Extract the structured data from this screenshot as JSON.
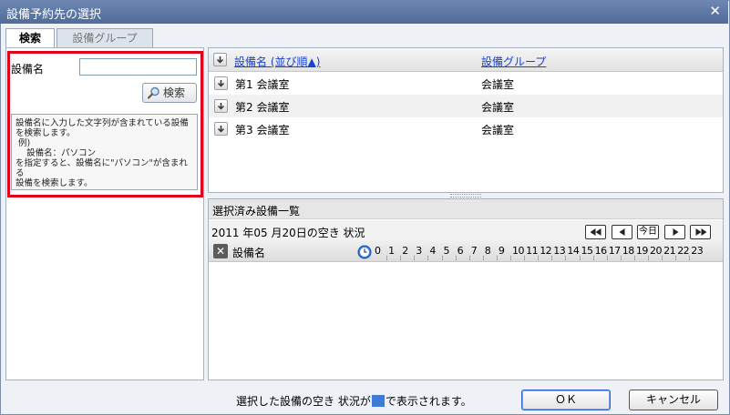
{
  "window": {
    "title": "設備予約先の選択"
  },
  "tabs": [
    {
      "label": "検索"
    },
    {
      "label": "設備グループ"
    }
  ],
  "search": {
    "label": "設備名",
    "input_value": "",
    "button_label": "検索",
    "help_text": "設備名に入力した文字列が含まれている設備\nを検索します。\n 例)\n    設備名：パソコン\nを指定すると、設備名に\"パソコン\"が含まれる\n設備を検索します。"
  },
  "table": {
    "columns": {
      "name": "設備名",
      "sort_label": "(並び順▲)",
      "group": "設備グループ"
    },
    "rows": [
      {
        "name": "第1 会議室",
        "group": "会議室"
      },
      {
        "name": "第2 会議室",
        "group": "会議室"
      },
      {
        "name": "第3 会議室",
        "group": "会議室"
      }
    ]
  },
  "selected": {
    "title": "選択済み設備一覧",
    "date_text": "2011 年05 月20日の空き 状況",
    "today_label": "今日",
    "column_label": "設備名",
    "hours": [
      "0",
      "1",
      "2",
      "3",
      "4",
      "5",
      "6",
      "7",
      "8",
      "9",
      "10",
      "11",
      "12",
      "13",
      "14",
      "15",
      "16",
      "17",
      "18",
      "19",
      "20",
      "21",
      "22",
      "23"
    ]
  },
  "footer": {
    "legend_before": "選択した設備の空き 状況が",
    "legend_after": "で表示されます。",
    "legend_color": "#3b7cd8",
    "ok_label": "ＯＫ",
    "cancel_label": "キャンセル"
  },
  "icons": {
    "close": "close-icon",
    "search": "magnifier-icon",
    "row": "arrow-down-icon",
    "clock": "clock-icon",
    "remove": "close-box-icon"
  }
}
